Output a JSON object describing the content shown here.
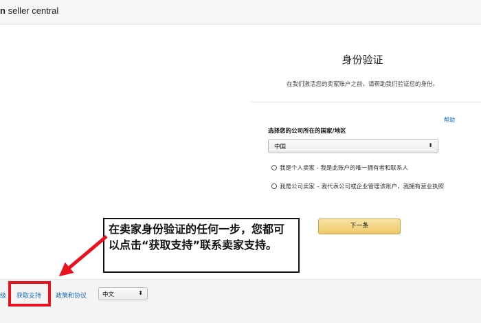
{
  "header": {
    "brand_prefix": "n",
    "brand_suffix": " seller central"
  },
  "verification": {
    "title": "身份验证",
    "subtitle": "在我们激活您的卖家账户之前，请帮助我们验证您的身份。",
    "help": "帮助",
    "country_label": "选择您的公司所在的国家/地区",
    "country_value": "中国",
    "option_individual": "我是个人卖家 - 我是此账户的唯一拥有者和联系人",
    "option_company": "我是公司卖家 – 我代表公司或企业管理该账户，我拥有营业执照",
    "next_button": "下一条"
  },
  "callout": {
    "text": "在卖家身份验证的任何一步，您都可以点击“获取支持”联系卖家支持。"
  },
  "footer": {
    "partial_link": "级",
    "support_link": "获取支持",
    "policy_link": "政策和协议",
    "language_value": "中文"
  },
  "colors": {
    "link": "#1a6bb6",
    "highlight": "#e8131f",
    "button": "#edc866"
  }
}
